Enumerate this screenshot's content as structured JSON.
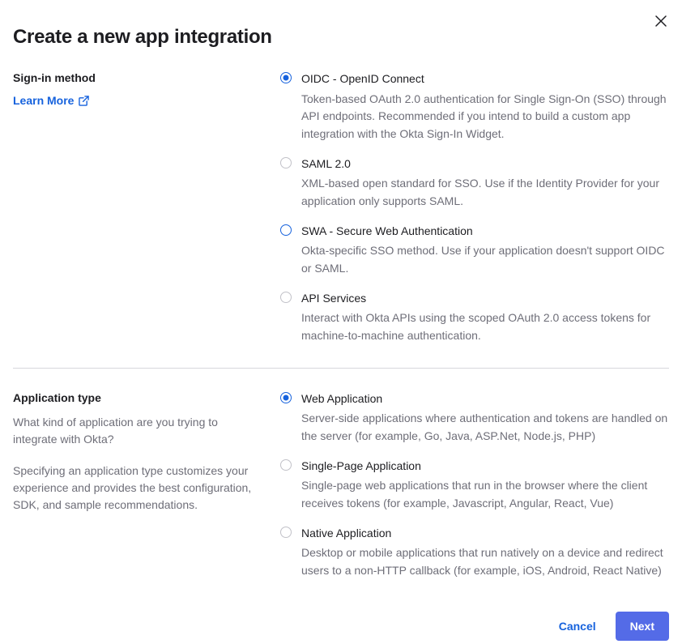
{
  "header": {
    "title": "Create a new app integration"
  },
  "sections": {
    "signin": {
      "label": "Sign-in method",
      "learn_more": "Learn More",
      "options": {
        "oidc": {
          "title": "OIDC - OpenID Connect",
          "desc": "Token-based OAuth 2.0 authentication for Single Sign-On (SSO) through API endpoints. Recommended if you intend to build a custom app integration with the Okta Sign-In Widget."
        },
        "saml": {
          "title": "SAML 2.0",
          "desc": "XML-based open standard for SSO. Use if the Identity Provider for your application only supports SAML."
        },
        "swa": {
          "title": "SWA - Secure Web Authentication",
          "desc": "Okta-specific SSO method. Use if your application doesn't support OIDC or SAML."
        },
        "api": {
          "title": "API Services",
          "desc": "Interact with Okta APIs using the scoped OAuth 2.0 access tokens for machine-to-machine authentication."
        }
      }
    },
    "apptype": {
      "label": "Application type",
      "desc1": "What kind of application are you trying to integrate with Okta?",
      "desc2": "Specifying an application type customizes your experience and provides the best configuration, SDK, and sample recommendations.",
      "options": {
        "web": {
          "title": "Web Application",
          "desc": "Server-side applications where authentication and tokens are handled on the server (for example, Go, Java, ASP.Net, Node.js, PHP)"
        },
        "spa": {
          "title": "Single-Page Application",
          "desc": "Single-page web applications that run in the browser where the client receives tokens (for example, Javascript, Angular, React, Vue)"
        },
        "native": {
          "title": "Native Application",
          "desc": "Desktop or mobile applications that run natively on a device and redirect users to a non-HTTP callback (for example, iOS, Android, React Native)"
        }
      }
    }
  },
  "footer": {
    "cancel": "Cancel",
    "next": "Next"
  }
}
